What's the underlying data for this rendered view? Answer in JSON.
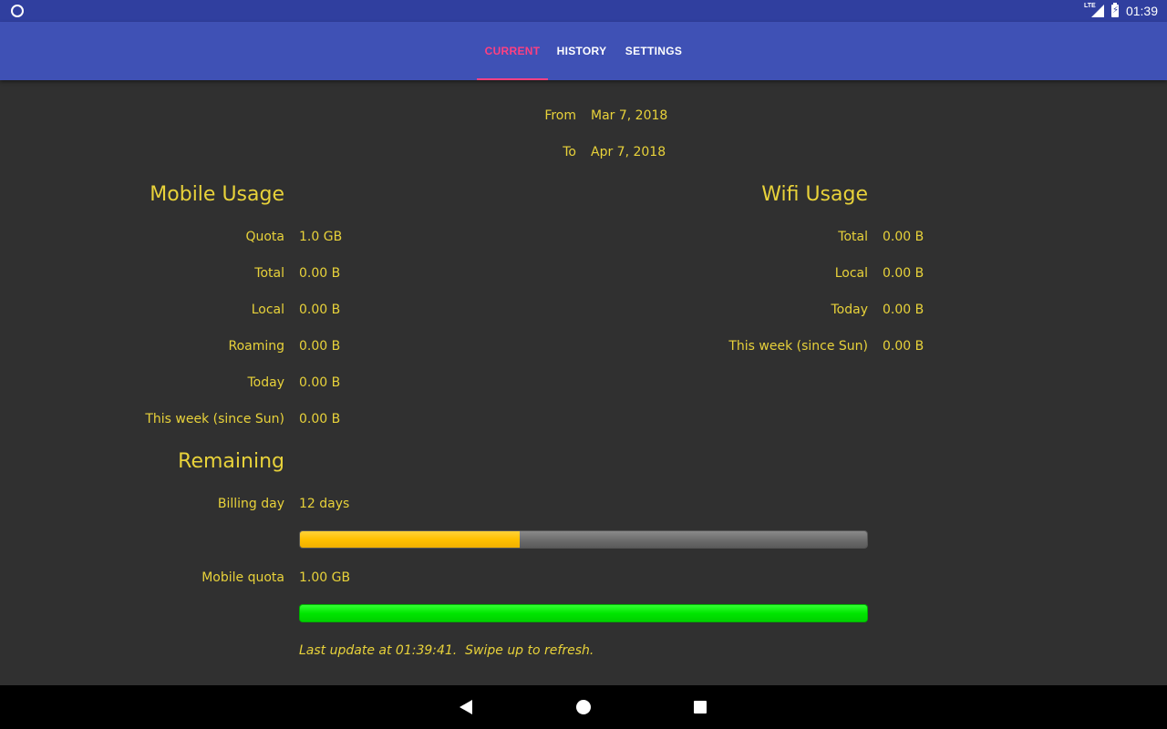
{
  "status_bar": {
    "network": "LTE",
    "time": "01:39"
  },
  "tabs": [
    {
      "label": "CURRENT",
      "active": true
    },
    {
      "label": "HISTORY",
      "active": false
    },
    {
      "label": "SETTINGS",
      "active": false
    }
  ],
  "period": {
    "from_label": "From",
    "from_value": "Mar 7, 2018",
    "to_label": "To",
    "to_value": "Apr 7, 2018"
  },
  "mobile": {
    "title": "Mobile Usage",
    "rows": [
      {
        "label": "Quota",
        "value": "1.0 GB"
      },
      {
        "label": "Total",
        "value": "0.00 B"
      },
      {
        "label": "Local",
        "value": "0.00 B"
      },
      {
        "label": "Roaming",
        "value": "0.00 B"
      },
      {
        "label": "Today",
        "value": "0.00 B"
      },
      {
        "label": "This week (since Sun)",
        "value": "0.00 B"
      }
    ]
  },
  "wifi": {
    "title": "Wifi Usage",
    "rows": [
      {
        "label": "Total",
        "value": "0.00 B"
      },
      {
        "label": "Local",
        "value": "0.00 B"
      },
      {
        "label": "Today",
        "value": "0.00 B"
      },
      {
        "label": "This week (since Sun)",
        "value": "0.00 B"
      }
    ]
  },
  "remaining": {
    "title": "Remaining",
    "billing_label": "Billing day",
    "billing_value": "12 days",
    "billing_progress_percent": 38.8,
    "quota_label": "Mobile quota",
    "quota_value": "1.00 GB",
    "quota_progress_percent": 100
  },
  "footer": {
    "note": "Last update at 01:39:41.  Swipe up to refresh."
  },
  "colors": {
    "app_bar": "#3f51b5",
    "status_bar": "#303f9f",
    "accent": "#ff4081",
    "text": "#e8d23a",
    "billing_fill": "#ffc000",
    "quota_fill": "#00e600"
  }
}
